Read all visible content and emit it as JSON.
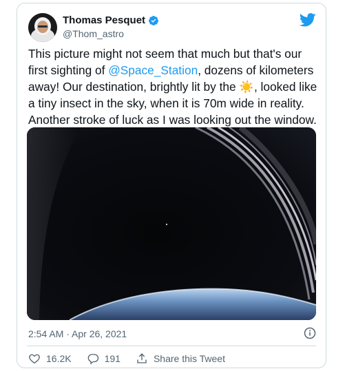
{
  "author": {
    "display_name": "Thomas Pesquet",
    "handle": "@Thom_astro",
    "verified": true
  },
  "tweet": {
    "text_before_mention": "This picture might not seem that much but that's our first sighting of ",
    "mention": "@Space_Station",
    "text_before_emoji": ", dozens of kilometers away! Our destination, brightly lit by the ",
    "emoji": "☀️",
    "text_after_emoji": ", looked like a tiny insect in the sky, when it is 70m wide in reality. Another stroke of luck as I was looking out the window."
  },
  "timestamp": "2:54 AM · Apr 26, 2021",
  "actions": {
    "likes": "16.2K",
    "replies": "191",
    "share_label": "Share this Tweet"
  },
  "colors": {
    "accent": "#1d9bf0",
    "text": "#0f1419",
    "muted": "#536471",
    "border": "#cfd9de"
  }
}
